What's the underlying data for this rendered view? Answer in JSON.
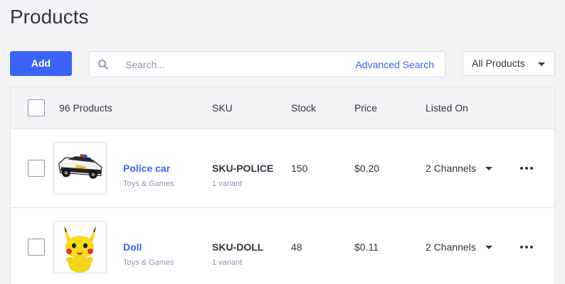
{
  "page": {
    "title": "Products"
  },
  "toolbar": {
    "add_label": "Add",
    "search_placeholder": "Search...",
    "advanced_search_label": "Advanced Search",
    "filter_selected": "All Products"
  },
  "table": {
    "headers": {
      "count": "96 Products",
      "sku": "SKU",
      "stock": "Stock",
      "price": "Price",
      "listed_on": "Listed On"
    },
    "rows": [
      {
        "name": "Police car",
        "category": "Toys & Games",
        "sku": "SKU-POLICE",
        "variants": "1 variant",
        "stock": "150",
        "price": "$0.20",
        "channels": "2 Channels",
        "image": "police-car-toy"
      },
      {
        "name": "Doll",
        "category": "Toys & Games",
        "sku": "SKU-DOLL",
        "variants": "1 variant",
        "stock": "48",
        "price": "$0.11",
        "channels": "2 Channels",
        "image": "pikachu-plush"
      }
    ]
  },
  "colors": {
    "accent": "#3c64f4",
    "text": "#313440",
    "muted": "#8c93ad",
    "background": "#f4f4f6",
    "border": "#d9dce9"
  },
  "icons": [
    "search-icon",
    "chevron-down-icon",
    "more-horizontal-icon"
  ]
}
